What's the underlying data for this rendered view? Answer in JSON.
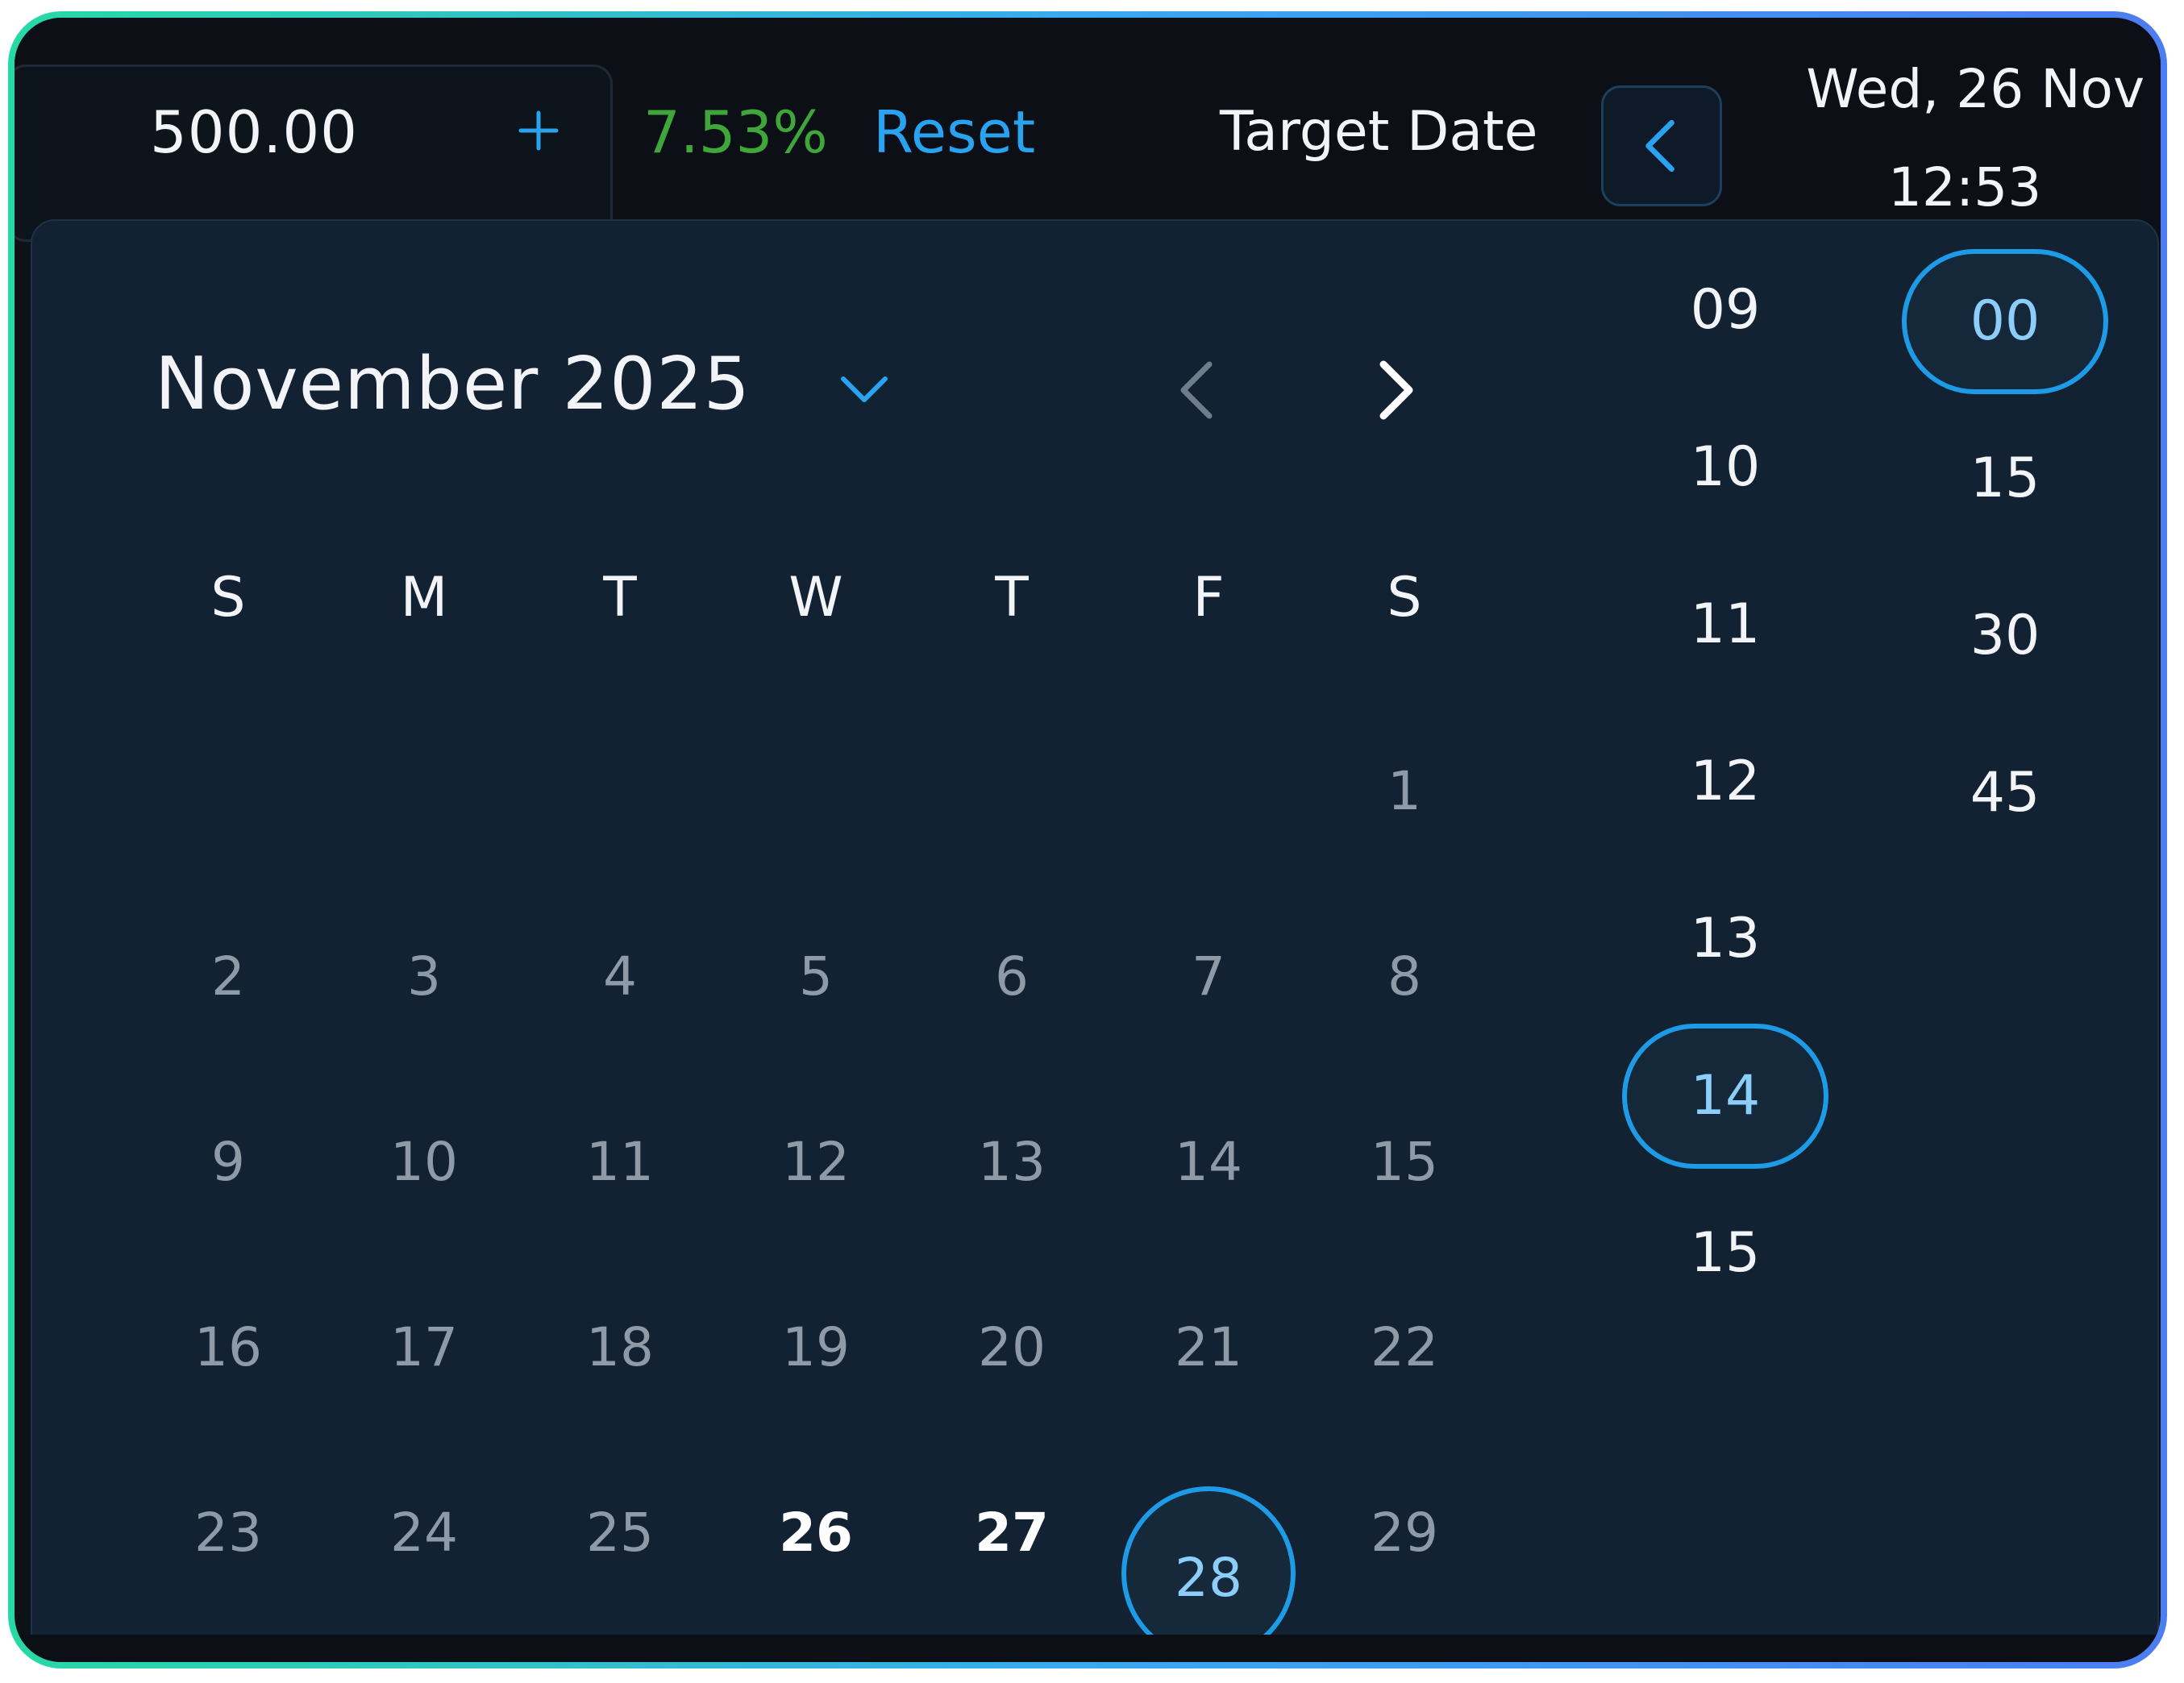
{
  "toolbar": {
    "amount_value": "500.00",
    "percent_text": "7.53%",
    "reset_label": "Reset",
    "target_date_label": "Target Date",
    "current_date": "Wed, 26 Nov",
    "current_time": "12:53"
  },
  "calendar": {
    "month_label": "November 2025",
    "weekdays": [
      "S",
      "M",
      "T",
      "W",
      "T",
      "F",
      "S"
    ],
    "days": [
      {
        "label": "1"
      },
      {
        "label": "2"
      },
      {
        "label": "3"
      },
      {
        "label": "4"
      },
      {
        "label": "5"
      },
      {
        "label": "6"
      },
      {
        "label": "7"
      },
      {
        "label": "8"
      },
      {
        "label": "9"
      },
      {
        "label": "10"
      },
      {
        "label": "11"
      },
      {
        "label": "12"
      },
      {
        "label": "13"
      },
      {
        "label": "14"
      },
      {
        "label": "15"
      },
      {
        "label": "16"
      },
      {
        "label": "17"
      },
      {
        "label": "18"
      },
      {
        "label": "19"
      },
      {
        "label": "20"
      },
      {
        "label": "21"
      },
      {
        "label": "22"
      },
      {
        "label": "23"
      },
      {
        "label": "24"
      },
      {
        "label": "25"
      },
      {
        "label": "26"
      },
      {
        "label": "27"
      },
      {
        "label": "28"
      },
      {
        "label": "29"
      }
    ],
    "selected_day": "28"
  },
  "time_picker": {
    "hours": [
      "09",
      "10",
      "11",
      "12",
      "13",
      "14",
      "15"
    ],
    "selected_hour": "14",
    "minutes": [
      "00",
      "15",
      "30",
      "45"
    ],
    "selected_minute": "00"
  },
  "colors": {
    "accent": "#1e9be6",
    "positive": "#3fa63a",
    "panel_bg": "#122232",
    "topbar_bg": "#0c1016"
  },
  "icons": {
    "amount_increment": "plus-icon",
    "target_prev": "chevron-left-icon",
    "month_dropdown": "chevron-down-icon",
    "month_prev": "chevron-left-icon",
    "month_next": "chevron-right-icon"
  }
}
